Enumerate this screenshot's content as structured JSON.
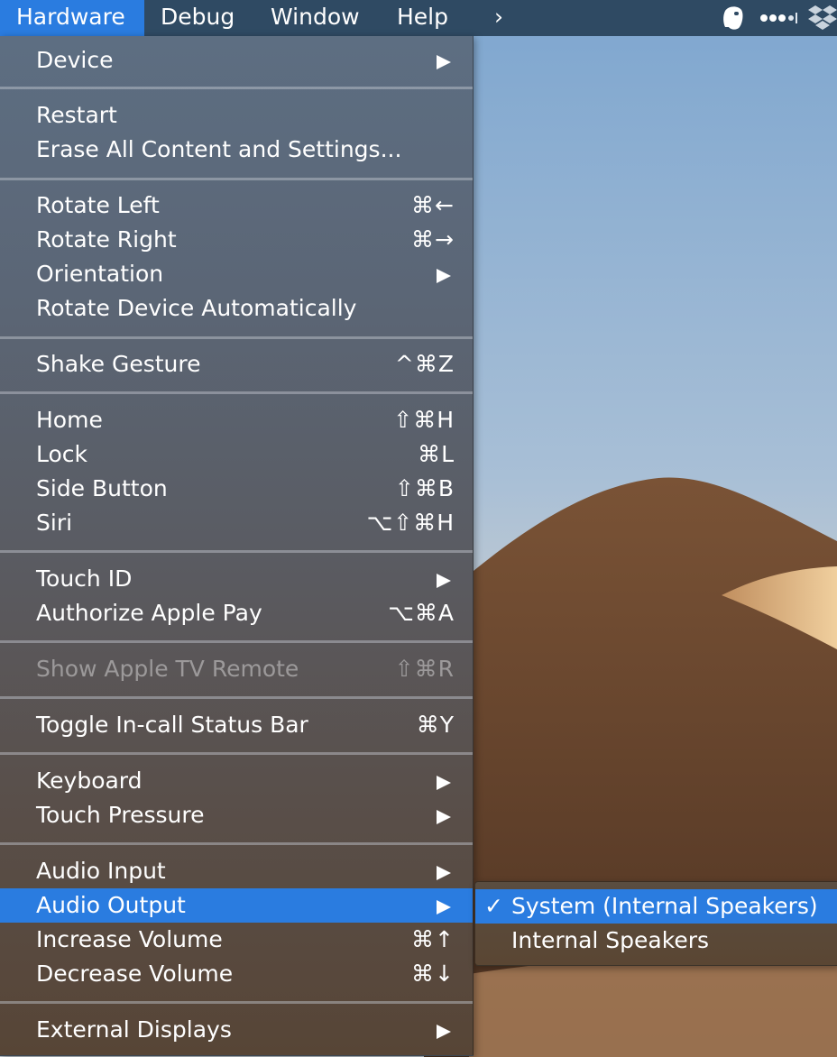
{
  "menubar": {
    "items": [
      {
        "label": "Hardware"
      },
      {
        "label": "Debug"
      },
      {
        "label": "Window"
      },
      {
        "label": "Help"
      }
    ],
    "overflow_glyph": "›",
    "status_icons": [
      "evernote-icon",
      "dots-icon",
      "dropbox-icon"
    ]
  },
  "menu": {
    "items": [
      {
        "label": "Device",
        "submenu": true
      },
      {
        "label": "Restart"
      },
      {
        "label": "Erase All Content and Settings..."
      },
      {
        "label": "Rotate Left",
        "shortcut": "⌘←"
      },
      {
        "label": "Rotate Right",
        "shortcut": "⌘→"
      },
      {
        "label": "Orientation",
        "submenu": true
      },
      {
        "label": "Rotate Device Automatically"
      },
      {
        "label": "Shake Gesture",
        "shortcut": "^⌘Z"
      },
      {
        "label": "Home",
        "shortcut": "⇧⌘H"
      },
      {
        "label": "Lock",
        "shortcut": "⌘L"
      },
      {
        "label": "Side Button",
        "shortcut": "⇧⌘B"
      },
      {
        "label": "Siri",
        "shortcut": "⌥⇧⌘H"
      },
      {
        "label": "Touch ID",
        "submenu": true
      },
      {
        "label": "Authorize Apple Pay",
        "shortcut": "⌥⌘A"
      },
      {
        "label": "Show Apple TV Remote",
        "shortcut": "⇧⌘R",
        "disabled": true
      },
      {
        "label": "Toggle In-call Status Bar",
        "shortcut": "⌘Y"
      },
      {
        "label": "Keyboard",
        "submenu": true
      },
      {
        "label": "Touch Pressure",
        "submenu": true
      },
      {
        "label": "Audio Input",
        "submenu": true
      },
      {
        "label": "Audio Output",
        "submenu": true,
        "selected": true
      },
      {
        "label": "Increase Volume",
        "shortcut": "⌘↑"
      },
      {
        "label": "Decrease Volume",
        "shortcut": "⌘↓"
      },
      {
        "label": "External Displays",
        "submenu": true
      }
    ]
  },
  "submenu": {
    "check_glyph": "✓",
    "items": [
      {
        "label": "System (Internal Speakers)",
        "checked": true
      },
      {
        "label": "Internal Speakers"
      }
    ]
  },
  "colors": {
    "menubar": "#2f4a63",
    "highlight": "#2a7ce0",
    "sky_top": "#7ea6cf",
    "dune": "#6e4b32"
  }
}
